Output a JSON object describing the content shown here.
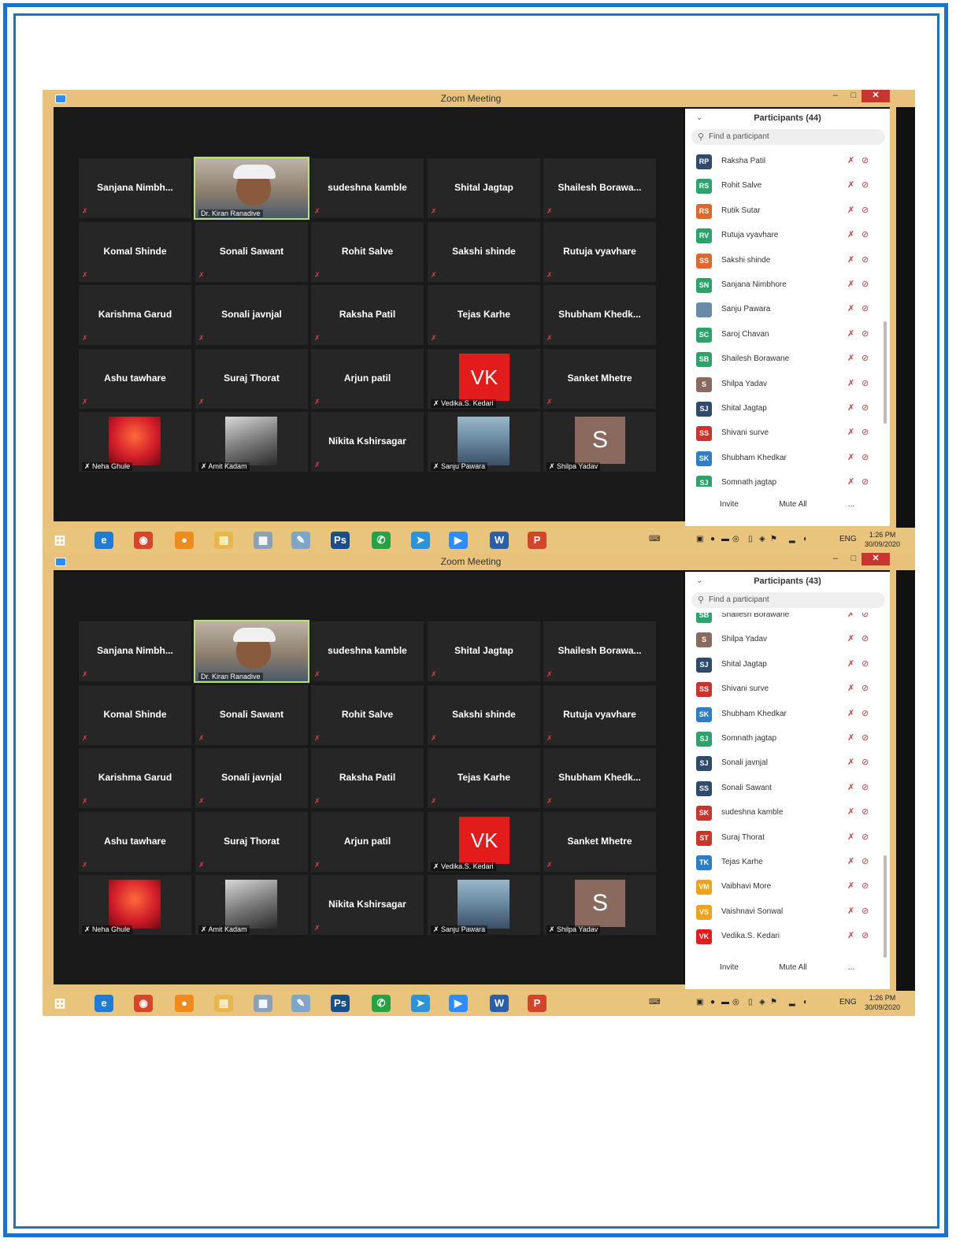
{
  "window_title": "Zoom Meeting",
  "window_controls": {
    "minimize": "–",
    "maximize": "□",
    "close": "✕"
  },
  "grid": [
    {
      "name": "Sanjana  Nimbh...",
      "kind": "text"
    },
    {
      "name": "Dr. Kiran Ranadive",
      "kind": "video-kiran"
    },
    {
      "name": "sudeshna kamble",
      "kind": "text"
    },
    {
      "name": "Shital Jagtap",
      "kind": "text"
    },
    {
      "name": "Shailesh  Borawa...",
      "kind": "text"
    },
    {
      "name": "Komal Shinde",
      "kind": "text"
    },
    {
      "name": "Sonali Sawant",
      "kind": "text"
    },
    {
      "name": "Rohit Salve",
      "kind": "text"
    },
    {
      "name": "Sakshi shinde",
      "kind": "text"
    },
    {
      "name": "Rutuja vyavhare",
      "kind": "text"
    },
    {
      "name": "Karishma Garud",
      "kind": "text"
    },
    {
      "name": "Sonali javnjal",
      "kind": "text"
    },
    {
      "name": "Raksha Patil",
      "kind": "text"
    },
    {
      "name": "Tejas Karhe",
      "kind": "text"
    },
    {
      "name": "Shubham  Khedk...",
      "kind": "text"
    },
    {
      "name": "Ashu tawhare",
      "kind": "text"
    },
    {
      "name": "Suraj Thorat",
      "kind": "text"
    },
    {
      "name": "Arjun patil",
      "kind": "text"
    },
    {
      "name": "Vedika.S. Kedari",
      "kind": "initials",
      "initials": "VK"
    },
    {
      "name": "Sanket Mhetre",
      "kind": "text"
    },
    {
      "name": "Neha Ghule",
      "kind": "image-ganesh"
    },
    {
      "name": "Amit Kadam",
      "kind": "image-amit"
    },
    {
      "name": "Nikita Kshirsagar",
      "kind": "text"
    },
    {
      "name": "Sanju Pawara",
      "kind": "image-sanju"
    },
    {
      "name": "Shilpa Yadav",
      "kind": "initials-s",
      "initials": "S"
    }
  ],
  "panel1": {
    "title": "Participants (44)",
    "search_placeholder": "Find a participant",
    "participants": [
      {
        "initials": "RP",
        "name": "Raksha Patil",
        "color": "#2f4a6b"
      },
      {
        "initials": "RS",
        "name": "Rohit Salve",
        "color": "#2ba36a"
      },
      {
        "initials": "RS",
        "name": "Rutik Sutar",
        "color": "#e0672b"
      },
      {
        "initials": "RV",
        "name": "Rutuja vyavhare",
        "color": "#2ba36a"
      },
      {
        "initials": "SS",
        "name": "Sakshi shinde",
        "color": "#e0672b"
      },
      {
        "initials": "SN",
        "name": "Sanjana Nimbhore",
        "color": "#2ba36a"
      },
      {
        "initials": "",
        "name": "Sanju Pawara",
        "color": "#6a8aa8"
      },
      {
        "initials": "SC",
        "name": "Saroj Chavan",
        "color": "#2ba36a"
      },
      {
        "initials": "SB",
        "name": "Shailesh Borawane",
        "color": "#2ba36a"
      },
      {
        "initials": "S",
        "name": "Shilpa Yadav",
        "color": "#8a6a5e"
      },
      {
        "initials": "SJ",
        "name": "Shital Jagtap",
        "color": "#2f4a6b"
      },
      {
        "initials": "SS",
        "name": "Shivani surve",
        "color": "#c9342d"
      },
      {
        "initials": "SK",
        "name": "Shubham Khedkar",
        "color": "#2b7fc9"
      },
      {
        "initials": "SJ",
        "name": "Somnath jagtap",
        "color": "#2ba36a"
      }
    ]
  },
  "panel2": {
    "title": "Participants (43)",
    "search_placeholder": "Find a participant",
    "participants": [
      {
        "initials": "SB",
        "name": "Shailesh Borawane",
        "color": "#2ba36a"
      },
      {
        "initials": "S",
        "name": "Shilpa Yadav",
        "color": "#8a6a5e"
      },
      {
        "initials": "SJ",
        "name": "Shital Jagtap",
        "color": "#2f4a6b"
      },
      {
        "initials": "SS",
        "name": "Shivani surve",
        "color": "#c9342d"
      },
      {
        "initials": "SK",
        "name": "Shubham Khedkar",
        "color": "#2b7fc9"
      },
      {
        "initials": "SJ",
        "name": "Somnath jagtap",
        "color": "#2ba36a"
      },
      {
        "initials": "SJ",
        "name": "Sonali javnjal",
        "color": "#2f4a6b"
      },
      {
        "initials": "SS",
        "name": "Sonali Sawant",
        "color": "#2f4a6b"
      },
      {
        "initials": "SK",
        "name": "sudeshna kamble",
        "color": "#c9342d"
      },
      {
        "initials": "ST",
        "name": "Suraj Thorat",
        "color": "#c9342d"
      },
      {
        "initials": "TK",
        "name": "Tejas Karhe",
        "color": "#2b7fc9"
      },
      {
        "initials": "VM",
        "name": "Vaibhavi More",
        "color": "#f0a21b"
      },
      {
        "initials": "VS",
        "name": "Vaishnavi Sonwal",
        "color": "#f0a21b"
      },
      {
        "initials": "VK",
        "name": "Vedika.S. Kedari",
        "color": "#e21b1b"
      }
    ]
  },
  "footer": {
    "invite": "Invite",
    "mute_all": "Mute All",
    "more": "..."
  },
  "taskbar": {
    "icons": [
      {
        "name": "windows-start-icon",
        "glyph": "⊞",
        "color": "#ffffff",
        "fg": "#ffffff"
      },
      {
        "name": "internet-explorer-icon",
        "glyph": "e",
        "color": "#1e7bd6",
        "fg": "#ffffff"
      },
      {
        "name": "chrome-icon",
        "glyph": "◉",
        "color": "#d9452b",
        "fg": "#ffffff"
      },
      {
        "name": "firefox-icon",
        "glyph": "●",
        "color": "#f08a1b",
        "fg": "#ffffff"
      },
      {
        "name": "file-explorer-icon",
        "glyph": "▤",
        "color": "#e8b64a",
        "fg": "#ffffff"
      },
      {
        "name": "calculator-icon",
        "glyph": "▦",
        "color": "#8aa1b8",
        "fg": "#ffffff"
      },
      {
        "name": "paint-icon",
        "glyph": "✎",
        "color": "#7fa5c9",
        "fg": "#ffffff"
      },
      {
        "name": "photoshop-icon",
        "glyph": "Ps",
        "color": "#1a4d8c",
        "fg": "#ffffff"
      },
      {
        "name": "whatsapp-icon",
        "glyph": "✆",
        "color": "#25a244",
        "fg": "#ffffff"
      },
      {
        "name": "telegram-icon",
        "glyph": "➤",
        "color": "#2b93d6",
        "fg": "#ffffff"
      },
      {
        "name": "zoom-icon",
        "glyph": "▶",
        "color": "#2d8cff",
        "fg": "#ffffff"
      },
      {
        "name": "word-icon",
        "glyph": "W",
        "color": "#2b5ea8",
        "fg": "#ffffff"
      },
      {
        "name": "powerpoint-icon",
        "glyph": "P",
        "color": "#d1452b",
        "fg": "#ffffff"
      }
    ],
    "lang": "ENG",
    "time": "1:26 PM",
    "date": "30/09/2020"
  }
}
